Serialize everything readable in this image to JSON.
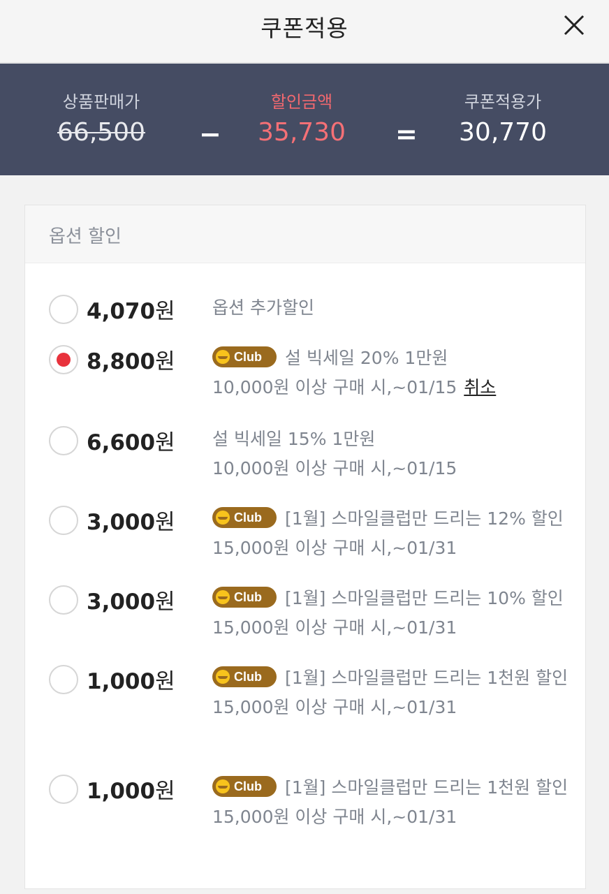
{
  "header": {
    "title": "쿠폰적용"
  },
  "summary": {
    "original_label": "상품판매가",
    "original_value": "66,500",
    "minus": "−",
    "discount_label": "할인금액",
    "discount_value": "35,730",
    "equals": "=",
    "final_label": "쿠폰적용가",
    "final_value": "30,770"
  },
  "section": {
    "title": "옵션 할인"
  },
  "badge": {
    "label": "Club"
  },
  "cancel_label": "취소",
  "won": "원",
  "options": [
    {
      "amount": "4,070",
      "selected": false,
      "club": false,
      "title": "옵션 추가할인",
      "condition": ""
    },
    {
      "amount": "8,800",
      "selected": true,
      "club": true,
      "title": "설 빅세일 20% 1만원",
      "condition": "10,000원 이상 구매 시,~01/15"
    },
    {
      "amount": "6,600",
      "selected": false,
      "club": false,
      "title": "설 빅세일 15% 1만원",
      "condition": "10,000원 이상 구매 시,~01/15"
    },
    {
      "amount": "3,000",
      "selected": false,
      "club": true,
      "title": "[1월] 스마일클럽만 드리는 12% 할인",
      "condition": "15,000원 이상 구매 시,~01/31"
    },
    {
      "amount": "3,000",
      "selected": false,
      "club": true,
      "title": "[1월] 스마일클럽만 드리는 10% 할인",
      "condition": "15,000원 이상 구매 시,~01/31"
    },
    {
      "amount": "1,000",
      "selected": false,
      "club": true,
      "title": "[1월] 스마일클럽만 드리는 1천원 할인",
      "condition": "15,000원 이상 구매 시,~01/31"
    },
    {
      "amount": "1,000",
      "selected": false,
      "club": true,
      "title": "[1월] 스마일클럽만 드리는 1천원 할인",
      "condition": "15,000원 이상 구매 시,~01/31"
    }
  ]
}
